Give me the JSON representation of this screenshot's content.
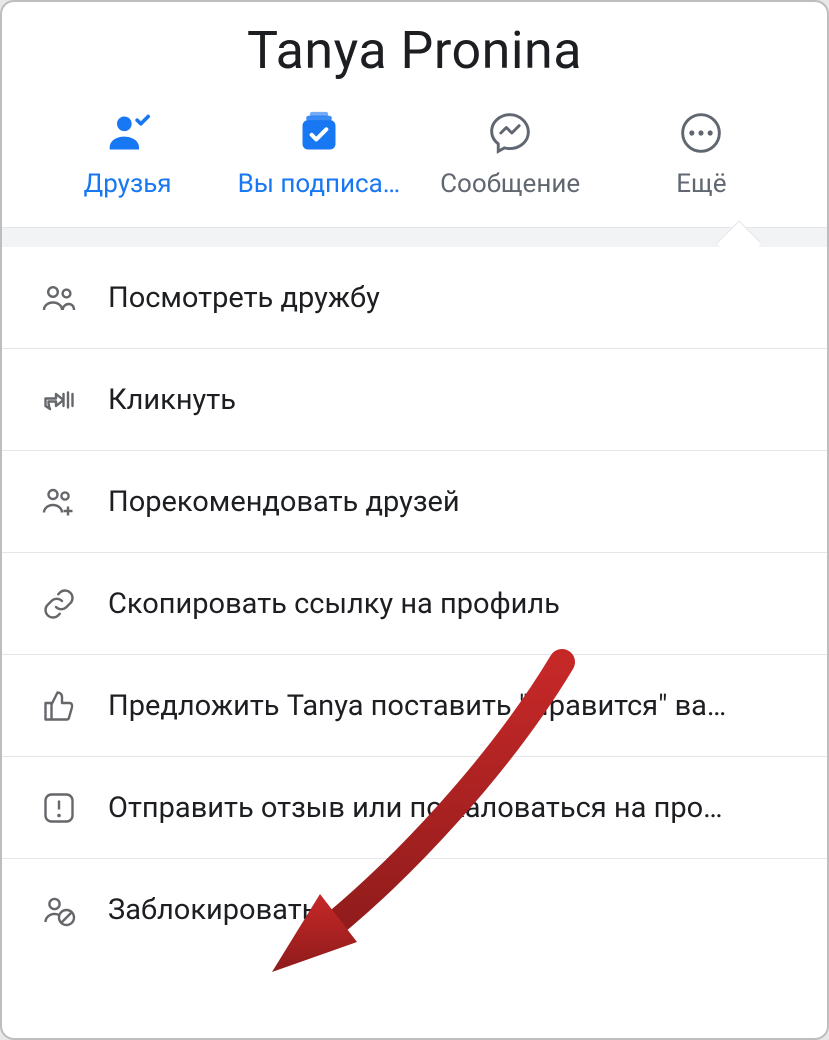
{
  "title": "Tanya Pronina",
  "actions": {
    "friends": {
      "label": "Друзья"
    },
    "subscribed": {
      "label": "Вы подписа…"
    },
    "message": {
      "label": "Сообщение"
    },
    "more": {
      "label": "Ещё"
    }
  },
  "menu": {
    "view_friendship": "Посмотреть дружбу",
    "poke": "Кликнуть",
    "suggest_friends": "Порекомендовать друзей",
    "copy_link": "Скопировать ссылку на профиль",
    "invite_like": "Предложить Tanya поставить \"Нравится\" ва…",
    "report": "Отправить отзыв или пожаловаться на про…",
    "block": "Заблокировать"
  }
}
